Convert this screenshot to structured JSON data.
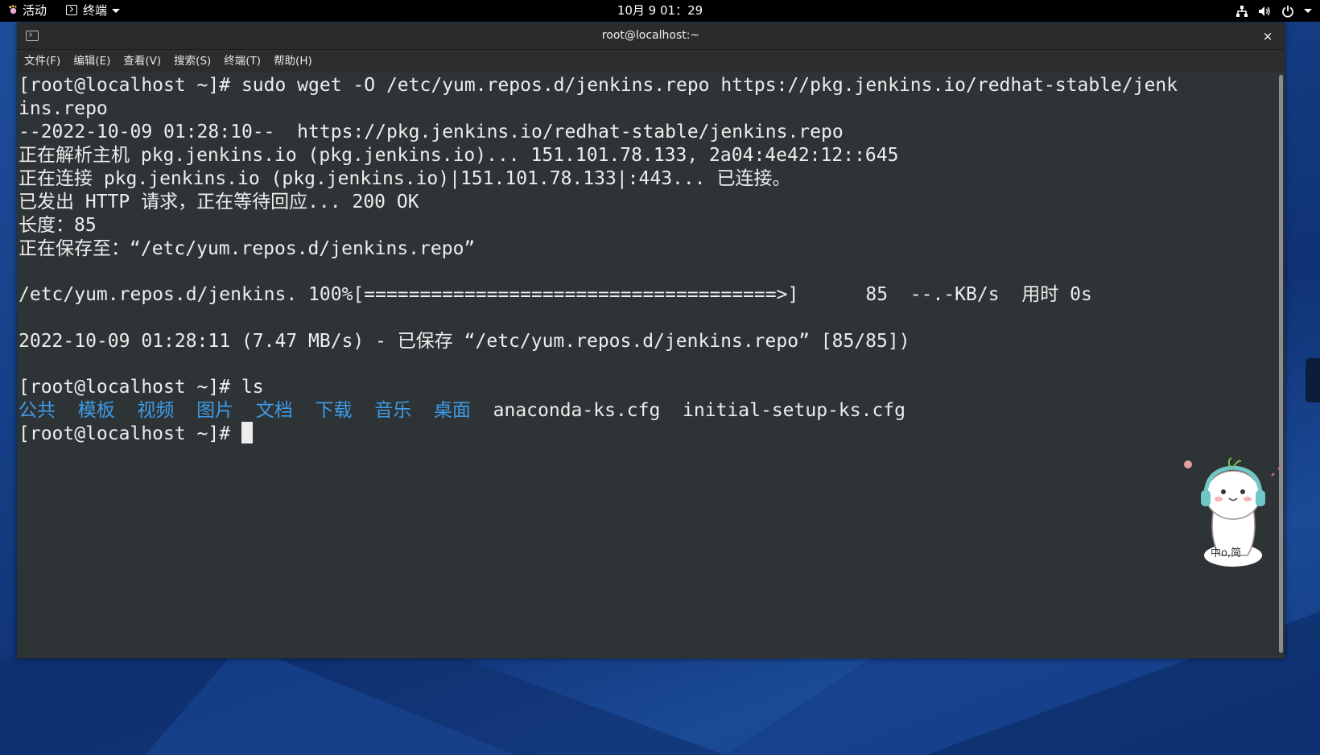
{
  "topbar": {
    "activities": "活动",
    "app_menu": "终端",
    "clock": "10月 9  01：29",
    "tray_icons": [
      "network-icon",
      "volume-icon",
      "power-icon"
    ]
  },
  "window": {
    "title": "root@localhost:~",
    "close": "×",
    "menus": [
      "文件(F)",
      "编辑(E)",
      "查看(V)",
      "搜索(S)",
      "终端(T)",
      "帮助(H)"
    ]
  },
  "terminal": {
    "lines": [
      "[root@localhost ~]# sudo wget -O /etc/yum.repos.d/jenkins.repo https://pkg.jenkins.io/redhat-stable/jenk",
      "ins.repo",
      "--2022-10-09 01:28:10--  https://pkg.jenkins.io/redhat-stable/jenkins.repo",
      "正在解析主机 pkg.jenkins.io (pkg.jenkins.io)... 151.101.78.133, 2a04:4e42:12::645",
      "正在连接 pkg.jenkins.io (pkg.jenkins.io)|151.101.78.133|:443... 已连接。",
      "已发出 HTTP 请求，正在等待回应... 200 OK",
      "长度：85",
      "正在保存至：“/etc/yum.repos.d/jenkins.repo”",
      "",
      "/etc/yum.repos.d/jenkins. 100%[=====================================>]      85  --.-KB/s  用时 0s",
      "",
      "2022-10-09 01:28:11 (7.47 MB/s) - 已保存 “/etc/yum.repos.d/jenkins.repo” [85/85])",
      "",
      "[root@localhost ~]# ls"
    ],
    "ls_dirs": [
      "公共",
      "模板",
      "视频",
      "图片",
      "文档",
      "下载",
      "音乐",
      "桌面"
    ],
    "ls_files": [
      "anaconda-ks.cfg",
      "initial-setup-ks.cfg"
    ],
    "prompt": "[root@localhost ~]# ",
    "dir_color": "#3f9ae6",
    "text_color": "#ededed",
    "background": "#2e3436"
  },
  "sticker": {
    "text": "中o,简"
  }
}
